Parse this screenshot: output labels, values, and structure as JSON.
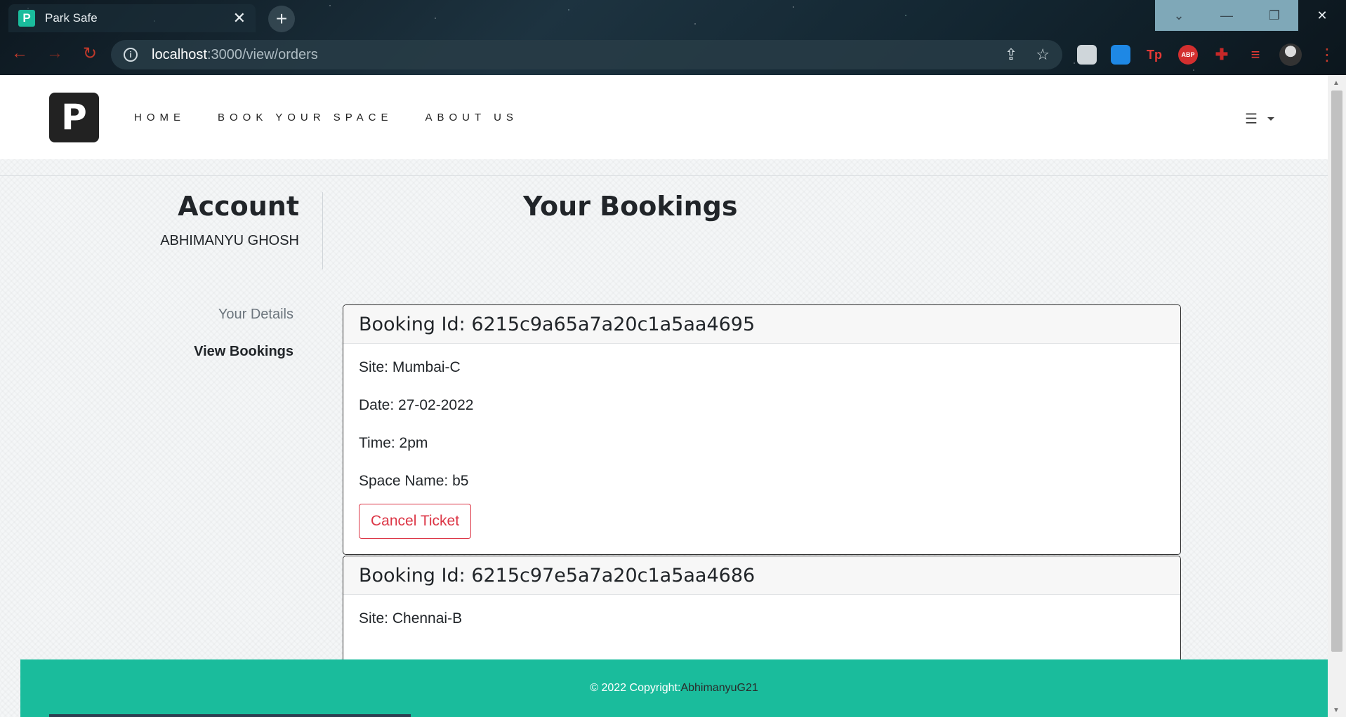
{
  "browser": {
    "tab_title": "Park Safe",
    "tab_favicon": "P",
    "url_host": "localhost",
    "url_path": ":3000/view/orders",
    "extensions": [
      {
        "name": "cube-extension-icon",
        "label": "",
        "color": "#cfd6da"
      },
      {
        "name": "translate-extension-icon",
        "label": "",
        "color": "#1e88e5"
      },
      {
        "name": "tp-extension-icon",
        "label": "Tp",
        "color": "#e53935"
      },
      {
        "name": "abp-extension-icon",
        "label": "ABP",
        "color": "#d32f2f"
      },
      {
        "name": "puzzle-extension-icon",
        "label": "",
        "color": "#c62828"
      },
      {
        "name": "playlist-extension-icon",
        "label": "",
        "color": "#e53935"
      }
    ]
  },
  "navbar": {
    "logo": "P",
    "links": [
      "HOME",
      "BOOK YOUR SPACE",
      "ABOUT US"
    ],
    "menu_icon": "☰"
  },
  "account": {
    "title": "Account",
    "name": "ABHIMANYU GHOSH"
  },
  "page_title": "Your Bookings",
  "side_menu": {
    "details": "Your Details",
    "view_bookings": "View Bookings"
  },
  "bookings": [
    {
      "id_label": "Booking Id: 6215c9a65a7a20c1a5aa4695",
      "site": "Site: Mumbai-C",
      "date": "Date: 27-02-2022",
      "time": "Time: 2pm",
      "space": "Space Name: b5",
      "cancel_label": "Cancel Ticket"
    },
    {
      "id_label": "Booking Id: 6215c97e5a7a20c1a5aa4686",
      "site": "Site: Chennai-B"
    }
  ],
  "footer": {
    "copyright": "© 2022 Copyright:",
    "author": "AbhimanyuG21"
  },
  "colors": {
    "accent": "#1abc9c",
    "danger": "#dc3545"
  }
}
